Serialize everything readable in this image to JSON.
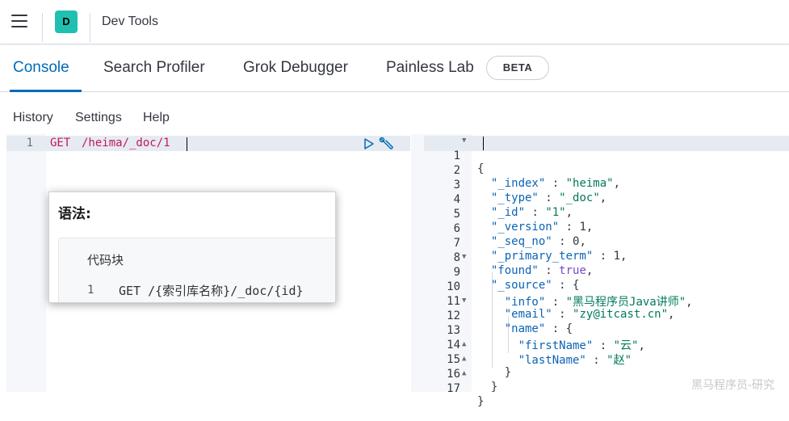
{
  "header": {
    "avatar_letter": "D",
    "app_title": "Dev Tools"
  },
  "tabs": [
    {
      "label": "Console",
      "active": true
    },
    {
      "label": "Search Profiler",
      "active": false
    },
    {
      "label": "Grok Debugger",
      "active": false
    },
    {
      "label": "Painless Lab",
      "active": false
    }
  ],
  "beta_badge": "BETA",
  "submenu": [
    "History",
    "Settings",
    "Help"
  ],
  "request": {
    "line_number": "1",
    "method": "GET",
    "path": "/heima/_doc/1"
  },
  "response": {
    "line_numbers": [
      "1",
      "2",
      "3",
      "4",
      "5",
      "6",
      "7",
      "8",
      "9",
      "10",
      "11",
      "12",
      "13",
      "14",
      "15",
      "16",
      "17"
    ],
    "open_brace": "{",
    "close_brace": "}",
    "index_key": "\"_index\"",
    "index_val": "\"heima\"",
    "type_key": "\"_type\"",
    "type_val": "\"_doc\"",
    "id_key": "\"_id\"",
    "id_val": "\"1\"",
    "version_key": "\"_version\"",
    "version_val": "1",
    "seq_key": "\"_seq_no\"",
    "seq_val": "0",
    "term_key": "\"_primary_term\"",
    "term_val": "1",
    "found_key": "\"found\"",
    "found_val": "true",
    "source_key": "\"_source\"",
    "info_key": "\"info\"",
    "info_val": "\"黑马程序员Java讲师\"",
    "email_key": "\"email\"",
    "email_val": "\"zy@itcast.cn\"",
    "name_key": "\"name\"",
    "first_key": "\"firstName\"",
    "first_val": "\"云\"",
    "last_key": "\"lastName\"",
    "last_val": "\"赵\""
  },
  "popup": {
    "title": "语法:",
    "codeblock_label": "代码块",
    "line_number": "1",
    "code": "GET /{索引库名称}/_doc/{id}"
  },
  "watermark": "黑马程序员-研究"
}
